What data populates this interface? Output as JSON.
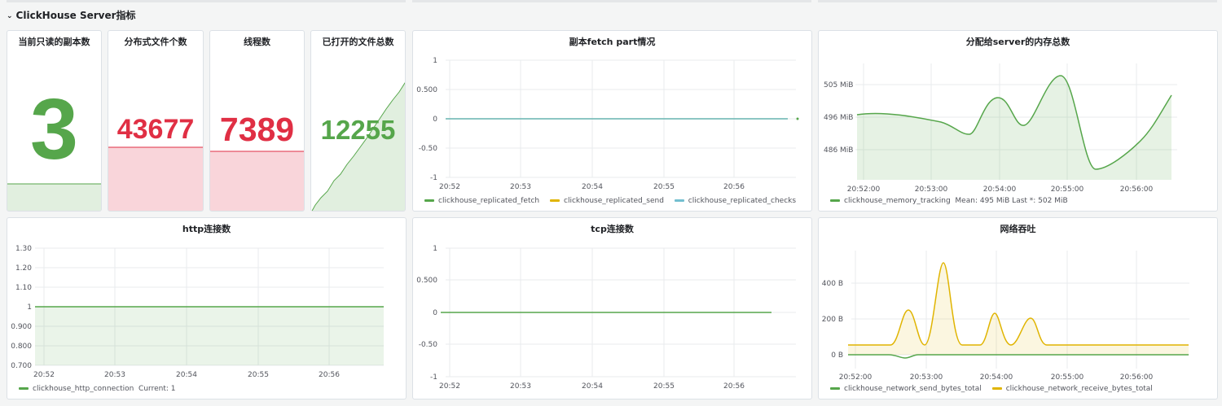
{
  "row": {
    "title": "ClickHouse Server指标"
  },
  "colors": {
    "green": "#56a64b",
    "red": "#e02f44",
    "yellow": "#e0b400",
    "cyan": "#73bfd0"
  },
  "stats": [
    {
      "title": "当前只读的副本数",
      "value": "3",
      "color": "#56a64b"
    },
    {
      "title": "分布式文件个数",
      "value": "43677",
      "color": "#e02f44"
    },
    {
      "title": "线程数",
      "value": "7389",
      "color": "#e02f44"
    },
    {
      "title": "已打开的文件总数",
      "value": "12255",
      "color": "#56a64b"
    }
  ],
  "panels": {
    "fetch": {
      "title": "副本fetch part情况",
      "legend": [
        {
          "label": "clickhouse_replicated_fetch",
          "color": "#56a64b"
        },
        {
          "label": "clickhouse_replicated_send",
          "color": "#e0b400"
        },
        {
          "label": "clickhouse_replicated_checks",
          "color": "#73bfd0"
        }
      ]
    },
    "memory": {
      "title": "分配给server的内存总数",
      "legend": [
        {
          "label": "clickhouse_memory_tracking",
          "color": "#56a64b",
          "extra": "Mean: 495 MiB   Last *: 502 MiB"
        }
      ]
    },
    "http": {
      "title": "http连接数",
      "legend": [
        {
          "label": "clickhouse_http_connection",
          "color": "#56a64b",
          "extra": "Current: 1"
        }
      ]
    },
    "tcp": {
      "title": "tcp连接数",
      "legend": []
    },
    "network": {
      "title": "网络吞吐",
      "legend": [
        {
          "label": "clickhouse_network_send_bytes_total",
          "color": "#56a64b"
        },
        {
          "label": "clickhouse_network_receive_bytes_total",
          "color": "#e0b400"
        }
      ]
    }
  },
  "chart_data": [
    {
      "id": "fetch",
      "type": "line",
      "title": "副本fetch part情况",
      "x": [
        "20:52",
        "20:53",
        "20:54",
        "20:55",
        "20:56"
      ],
      "y_ticks": [
        "1",
        "0.500",
        "0",
        "-0.50",
        "-1"
      ],
      "ylim": [
        -1,
        1
      ],
      "series": [
        {
          "name": "clickhouse_replicated_fetch",
          "values": [
            0,
            0,
            0,
            0,
            0
          ]
        },
        {
          "name": "clickhouse_replicated_send",
          "values": [
            0,
            0,
            0,
            0,
            0
          ]
        },
        {
          "name": "clickhouse_replicated_checks",
          "values": [
            0,
            0,
            0,
            0,
            0
          ]
        }
      ]
    },
    {
      "id": "memory",
      "type": "area",
      "title": "分配给server的内存总数",
      "x": [
        "20:52:00",
        "20:53:00",
        "20:54:00",
        "20:55:00",
        "20:56:00"
      ],
      "y_ticks": [
        "505 MiB",
        "496 MiB",
        "486 MiB"
      ],
      "series": [
        {
          "name": "clickhouse_memory_tracking",
          "points": [
            [
              "20:52:00",
              497
            ],
            [
              "20:53:15",
              495
            ],
            [
              "20:53:40",
              491
            ],
            [
              "20:54:15",
              502
            ],
            [
              "20:54:40",
              494
            ],
            [
              "20:55:00",
              507
            ],
            [
              "20:55:30",
              482
            ],
            [
              "20:56:00",
              488
            ],
            [
              "20:56:40",
              502
            ]
          ]
        }
      ]
    },
    {
      "id": "http",
      "type": "area",
      "title": "http连接数",
      "x": [
        "20:52",
        "20:53",
        "20:54",
        "20:55",
        "20:56"
      ],
      "y_ticks": [
        "1.30",
        "1.20",
        "1.10",
        "1",
        "0.900",
        "0.800",
        "0.700"
      ],
      "ylim": [
        0.7,
        1.3
      ],
      "series": [
        {
          "name": "clickhouse_http_connection",
          "values": [
            1,
            1,
            1,
            1,
            1
          ]
        }
      ]
    },
    {
      "id": "tcp",
      "type": "line",
      "title": "tcp连接数",
      "x": [
        "20:52",
        "20:53",
        "20:54",
        "20:55",
        "20:56"
      ],
      "y_ticks": [
        "1",
        "0.500",
        "0",
        "-0.50",
        "-1"
      ],
      "ylim": [
        -1,
        1
      ],
      "series": [
        {
          "name": "",
          "values": [
            0,
            0,
            0,
            0,
            0
          ]
        }
      ]
    },
    {
      "id": "network",
      "type": "area",
      "title": "网络吞吐",
      "x": [
        "20:52:00",
        "20:53:00",
        "20:54:00",
        "20:55:00",
        "20:56:00"
      ],
      "y_ticks": [
        "400 B",
        "200 B",
        "0 B"
      ],
      "series": [
        {
          "name": "clickhouse_network_send_bytes_total",
          "values": [
            0,
            0,
            0,
            0,
            0
          ]
        },
        {
          "name": "clickhouse_network_receive_bytes_total",
          "points": [
            [
              "20:52:00",
              55
            ],
            [
              "20:52:40",
              250
            ],
            [
              "20:53:08",
              520
            ],
            [
              "20:53:50",
              235
            ],
            [
              "20:54:25",
              210
            ],
            [
              "20:56:40",
              55
            ]
          ]
        }
      ]
    }
  ]
}
